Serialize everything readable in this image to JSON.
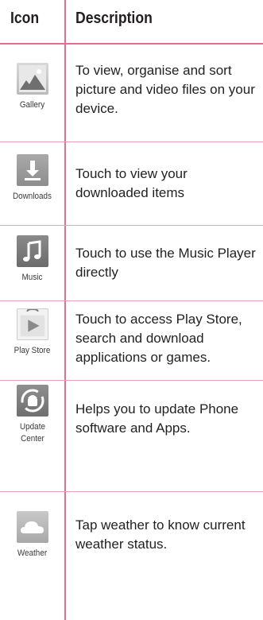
{
  "header": {
    "icon_col": "Icon",
    "desc_col": "Description"
  },
  "rows": [
    {
      "icon": "gallery-icon",
      "label": "Gallery",
      "description": "To view, organise and sort picture and video files on your device."
    },
    {
      "icon": "downloads-icon",
      "label": "Downloads",
      "description": "Touch to view your downloaded items"
    },
    {
      "icon": "music-icon",
      "label": "Music",
      "description": "Touch to use the Music Player directly"
    },
    {
      "icon": "play-store-icon",
      "label": "Play Store",
      "description": "Touch to access Play Store, search and download applications or games."
    },
    {
      "icon": "update-center-icon",
      "label": "Update Center",
      "description": "Helps you to update Phone software and  Apps."
    },
    {
      "icon": "weather-icon",
      "label": "Weather",
      "description": "Tap weather to know current weather status."
    }
  ],
  "colors": {
    "rule": "#e36f8c",
    "row_rule": "#e9a3b5",
    "text": "#231f20"
  }
}
